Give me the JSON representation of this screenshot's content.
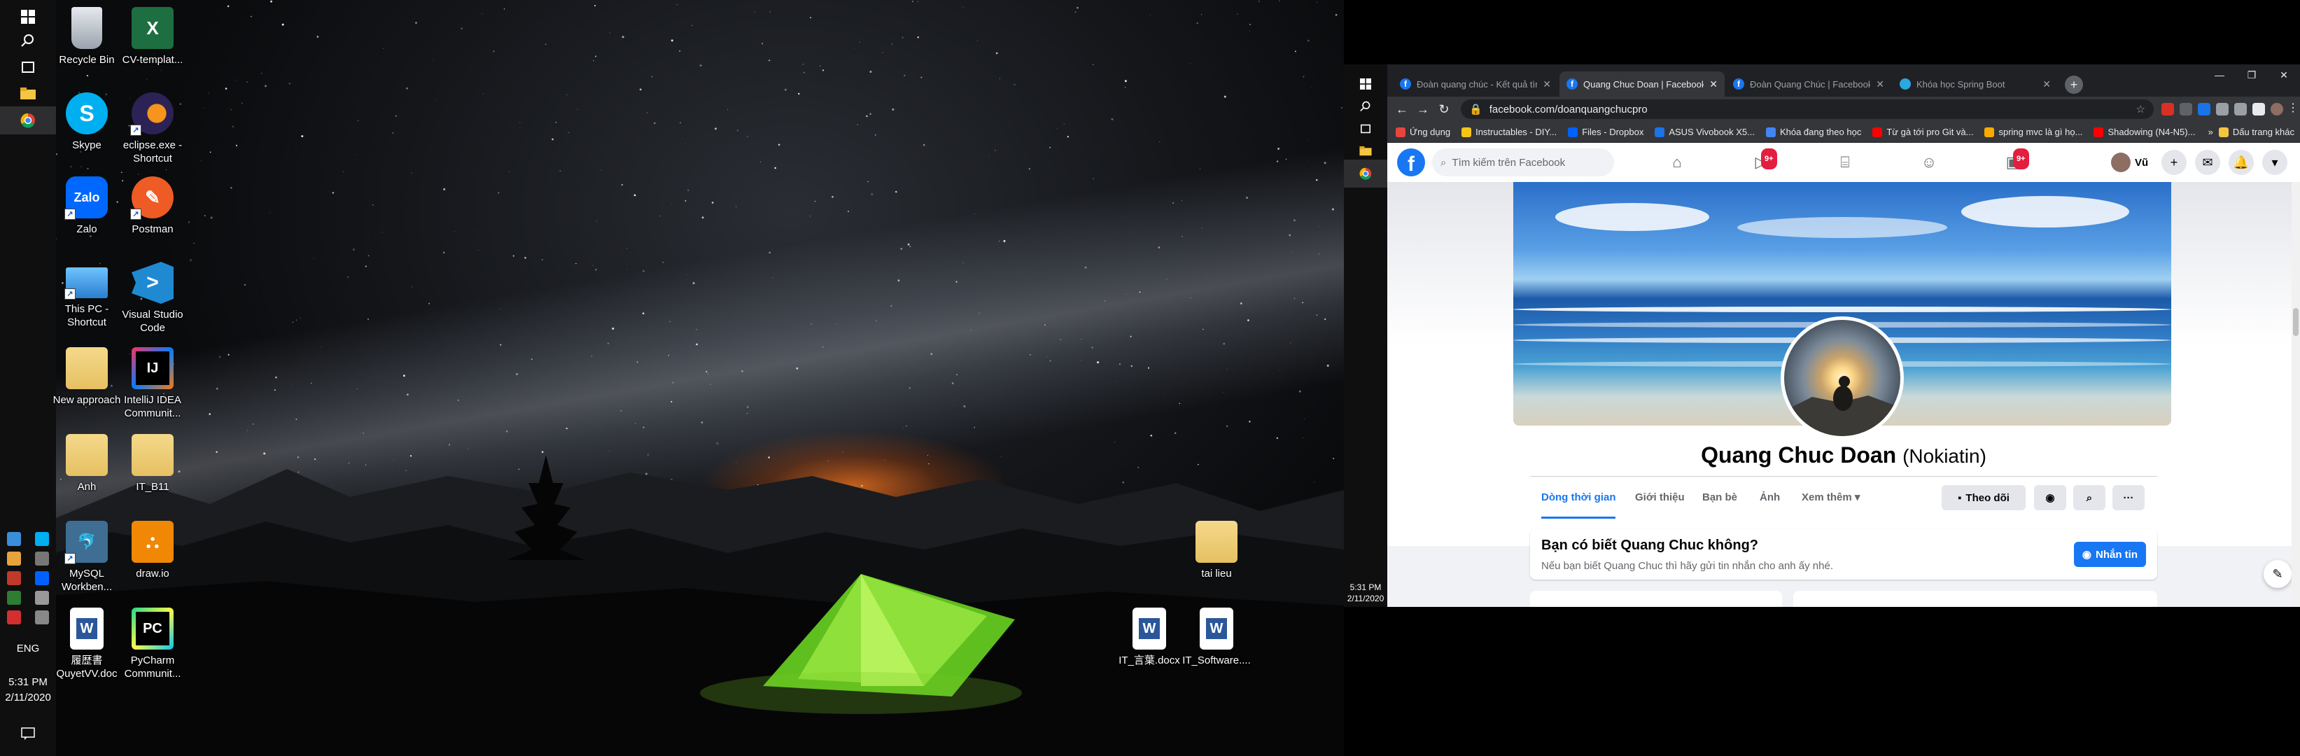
{
  "left_taskbar": {
    "language": "ENG",
    "time": "5:31 PM",
    "date": "2/11/2020"
  },
  "desktop_icons": [
    {
      "label": "Recycle Bin",
      "icon": "recycle-bin-icon"
    },
    {
      "label": "CV-templat...",
      "icon": "excel-icon"
    },
    {
      "label": "Skype",
      "icon": "skype-icon"
    },
    {
      "label": "eclipse.exe - Shortcut",
      "icon": "eclipse-icon"
    },
    {
      "label": "Zalo",
      "icon": "zalo-icon"
    },
    {
      "label": "Postman",
      "icon": "postman-icon"
    },
    {
      "label": "This PC - Shortcut",
      "icon": "computer-icon"
    },
    {
      "label": "Visual Studio Code",
      "icon": "vscode-icon"
    },
    {
      "label": "New approach",
      "icon": "folder-icon"
    },
    {
      "label": "IntelliJ IDEA Communit...",
      "icon": "intellij-icon"
    },
    {
      "label": "Anh",
      "icon": "folder-icon"
    },
    {
      "label": "IT_B11",
      "icon": "folder-icon"
    },
    {
      "label": "MySQL Workben...",
      "icon": "mysql-icon"
    },
    {
      "label": "draw.io",
      "icon": "drawio-icon"
    },
    {
      "label": "履歴書 QuyetVV.doc",
      "icon": "word-icon"
    },
    {
      "label": "PyCharm Communit...",
      "icon": "pycharm-icon"
    },
    {
      "label": "tai lieu",
      "icon": "folder-icon"
    },
    {
      "label": "IT_言葉.docx",
      "icon": "word-icon"
    },
    {
      "label": "IT_Software....",
      "icon": "word-icon"
    }
  ],
  "right_taskbar": {
    "time": "5:31 PM",
    "date": "2/11/2020"
  },
  "browser": {
    "tabs": [
      {
        "title": "Đoàn quang chúc - Kết quả tìm...",
        "active": false
      },
      {
        "title": "Quang Chuc Doan | Facebook",
        "active": true
      },
      {
        "title": "Đoàn Quang Chúc | Facebook",
        "active": false
      },
      {
        "title": "Khóa học Spring Boot",
        "active": false
      }
    ],
    "new_tab": "+",
    "url": "facebook.com/doanquangchucpro",
    "bookmarks": [
      {
        "label": "Ứng dụng",
        "color": "#e8453c"
      },
      {
        "label": "Instructables - DIY...",
        "color": "#f5c518"
      },
      {
        "label": "Files - Dropbox",
        "color": "#0061fe"
      },
      {
        "label": "ASUS Vivobook X5...",
        "color": "#1a73e8"
      },
      {
        "label": "Khóa đang theo học",
        "color": "#4285f4"
      },
      {
        "label": "Từ gà tới pro Git và...",
        "color": "#ff0000"
      },
      {
        "label": "spring mvc là gì họ...",
        "color": "#f9ab00"
      },
      {
        "label": "Shadowing (N4-N5)...",
        "color": "#ff0000"
      }
    ],
    "bookmarks_more": "»",
    "bookmarks_other": "Dấu trang khác"
  },
  "facebook": {
    "search_placeholder": "Tìm kiếm trên Facebook",
    "badge_video": "9+",
    "badge_groups": "9+",
    "user_name": "Vũ",
    "profile_name": "Quang Chuc Doan",
    "profile_alt_name": "(Nokiatin)",
    "tabs": [
      "Dòng thời gian",
      "Giới thiệu",
      "Bạn bè",
      "Ảnh",
      "Xem thêm ▾"
    ],
    "follow_button": "Theo dõi",
    "know_title": "Bạn có biết Quang Chuc không?",
    "know_subtitle": "Nếu bạn biết Quang Chuc thì hãy gửi tin nhắn cho anh ấy nhé.",
    "message_button": "Nhắn tin"
  },
  "colors": {
    "facebook_blue": "#1877f2",
    "chrome_dark": "#35363a",
    "taskbar": "#0f0f10"
  }
}
